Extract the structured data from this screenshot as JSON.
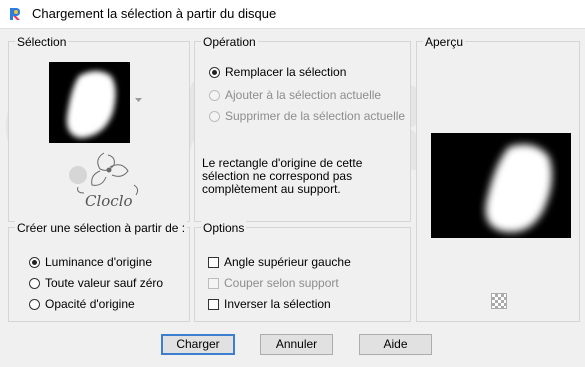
{
  "window": {
    "title": "Chargement la sélection à partir du disque"
  },
  "selection_panel": {
    "title": "Sélection",
    "logo_text": "Cloclo"
  },
  "operation": {
    "title": "Opération",
    "options": [
      {
        "label": "Remplacer la sélection",
        "checked": true,
        "enabled": true
      },
      {
        "label": "Ajouter à la sélection actuelle",
        "checked": false,
        "enabled": false
      },
      {
        "label": "Supprimer de la sélection actuelle",
        "checked": false,
        "enabled": false
      }
    ],
    "message": [
      "Le rectangle d'origine de cette",
      "sélection ne correspond pas",
      "complètement au support."
    ]
  },
  "preview": {
    "title": "Aperçu"
  },
  "create_from": {
    "title": "Créer une sélection à partir de :",
    "options": [
      {
        "label": "Luminance d'origine",
        "checked": true
      },
      {
        "label": "Toute valeur sauf zéro",
        "checked": false
      },
      {
        "label": "Opacité d'origine",
        "checked": false
      }
    ]
  },
  "options_group": {
    "title": "Options",
    "items": [
      {
        "label": "Angle supérieur gauche",
        "checked": false,
        "enabled": true
      },
      {
        "label": "Couper selon support",
        "checked": false,
        "enabled": false
      },
      {
        "label": "Inverser la sélection",
        "checked": false,
        "enabled": true
      }
    ]
  },
  "buttons": {
    "load": "Charger",
    "cancel": "Annuler",
    "help": "Aide"
  },
  "colors": {
    "default_button_border": "#3c7fd1",
    "group_border": "#d5d5d5",
    "disabled_text": "#8d8d8d"
  }
}
